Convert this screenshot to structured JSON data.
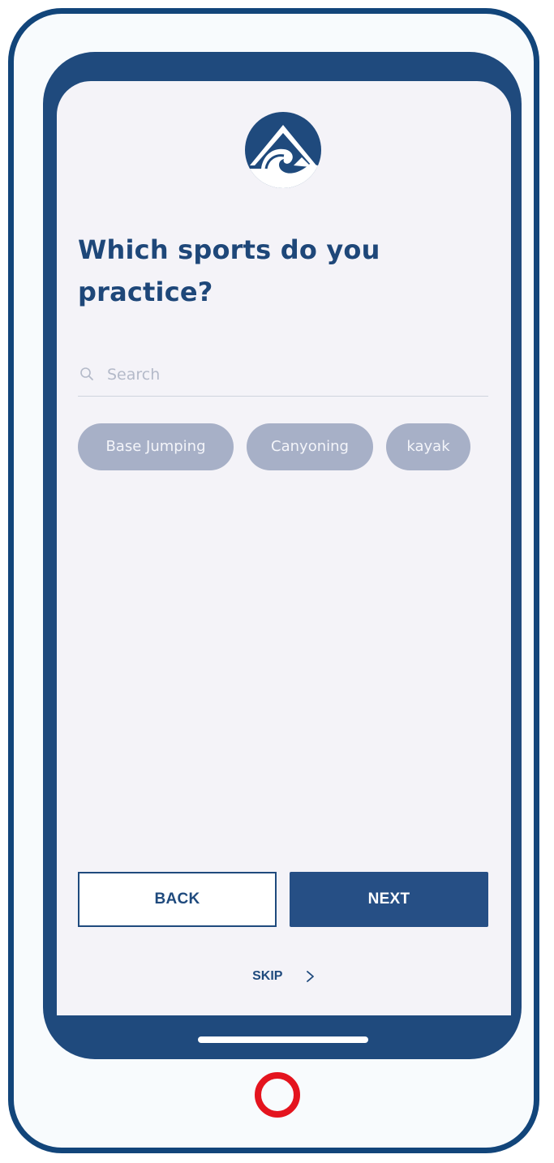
{
  "header": {
    "logo_icon": "mountain-wave-logo-icon"
  },
  "question": {
    "title_line1": "Which sports do you",
    "title_line2": "practice?"
  },
  "search": {
    "icon": "search-icon",
    "placeholder": "Search",
    "value": ""
  },
  "sports": {
    "chips": [
      {
        "label": "Base Jumping"
      },
      {
        "label": "Canyoning"
      },
      {
        "label": "kayak"
      }
    ]
  },
  "actions": {
    "back_label": "BACK",
    "next_label": "NEXT",
    "skip_label": "SKIP",
    "skip_icon": "chevron-right-icon"
  },
  "colors": {
    "brand_navy": "#1f4a7d",
    "chip_bg": "#a7b0c7",
    "screen_bg": "#f4f3f8",
    "home_button_red": "#e4141e"
  }
}
